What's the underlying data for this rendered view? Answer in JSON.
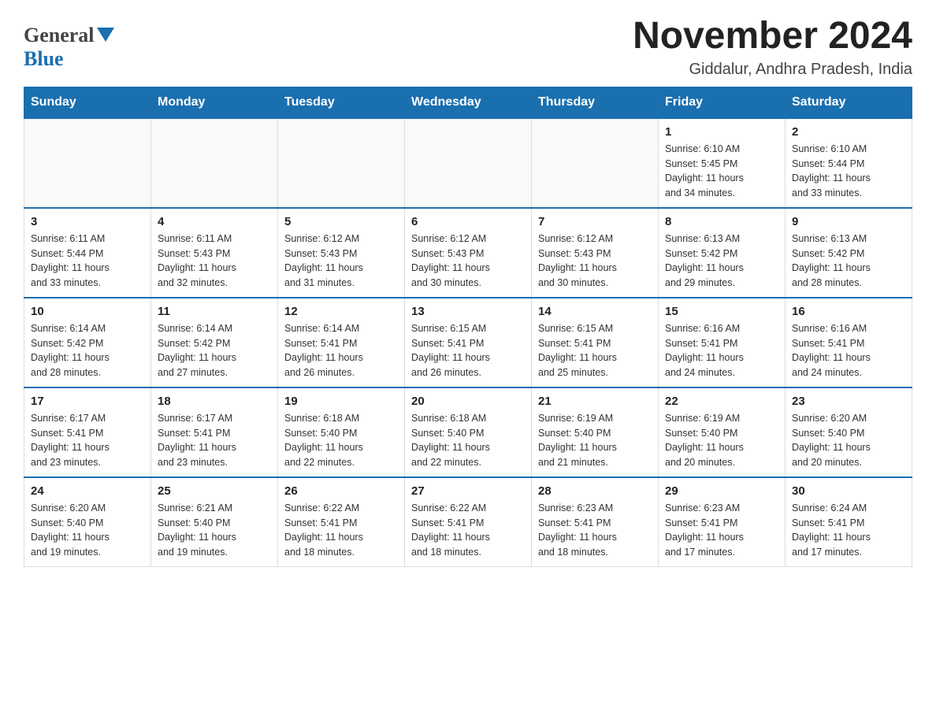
{
  "logo": {
    "general": "General",
    "blue": "Blue"
  },
  "header": {
    "title": "November 2024",
    "subtitle": "Giddalur, Andhra Pradesh, India"
  },
  "days_of_week": [
    "Sunday",
    "Monday",
    "Tuesday",
    "Wednesday",
    "Thursday",
    "Friday",
    "Saturday"
  ],
  "weeks": [
    [
      {
        "day": "",
        "info": ""
      },
      {
        "day": "",
        "info": ""
      },
      {
        "day": "",
        "info": ""
      },
      {
        "day": "",
        "info": ""
      },
      {
        "day": "",
        "info": ""
      },
      {
        "day": "1",
        "info": "Sunrise: 6:10 AM\nSunset: 5:45 PM\nDaylight: 11 hours\nand 34 minutes."
      },
      {
        "day": "2",
        "info": "Sunrise: 6:10 AM\nSunset: 5:44 PM\nDaylight: 11 hours\nand 33 minutes."
      }
    ],
    [
      {
        "day": "3",
        "info": "Sunrise: 6:11 AM\nSunset: 5:44 PM\nDaylight: 11 hours\nand 33 minutes."
      },
      {
        "day": "4",
        "info": "Sunrise: 6:11 AM\nSunset: 5:43 PM\nDaylight: 11 hours\nand 32 minutes."
      },
      {
        "day": "5",
        "info": "Sunrise: 6:12 AM\nSunset: 5:43 PM\nDaylight: 11 hours\nand 31 minutes."
      },
      {
        "day": "6",
        "info": "Sunrise: 6:12 AM\nSunset: 5:43 PM\nDaylight: 11 hours\nand 30 minutes."
      },
      {
        "day": "7",
        "info": "Sunrise: 6:12 AM\nSunset: 5:43 PM\nDaylight: 11 hours\nand 30 minutes."
      },
      {
        "day": "8",
        "info": "Sunrise: 6:13 AM\nSunset: 5:42 PM\nDaylight: 11 hours\nand 29 minutes."
      },
      {
        "day": "9",
        "info": "Sunrise: 6:13 AM\nSunset: 5:42 PM\nDaylight: 11 hours\nand 28 minutes."
      }
    ],
    [
      {
        "day": "10",
        "info": "Sunrise: 6:14 AM\nSunset: 5:42 PM\nDaylight: 11 hours\nand 28 minutes."
      },
      {
        "day": "11",
        "info": "Sunrise: 6:14 AM\nSunset: 5:42 PM\nDaylight: 11 hours\nand 27 minutes."
      },
      {
        "day": "12",
        "info": "Sunrise: 6:14 AM\nSunset: 5:41 PM\nDaylight: 11 hours\nand 26 minutes."
      },
      {
        "day": "13",
        "info": "Sunrise: 6:15 AM\nSunset: 5:41 PM\nDaylight: 11 hours\nand 26 minutes."
      },
      {
        "day": "14",
        "info": "Sunrise: 6:15 AM\nSunset: 5:41 PM\nDaylight: 11 hours\nand 25 minutes."
      },
      {
        "day": "15",
        "info": "Sunrise: 6:16 AM\nSunset: 5:41 PM\nDaylight: 11 hours\nand 24 minutes."
      },
      {
        "day": "16",
        "info": "Sunrise: 6:16 AM\nSunset: 5:41 PM\nDaylight: 11 hours\nand 24 minutes."
      }
    ],
    [
      {
        "day": "17",
        "info": "Sunrise: 6:17 AM\nSunset: 5:41 PM\nDaylight: 11 hours\nand 23 minutes."
      },
      {
        "day": "18",
        "info": "Sunrise: 6:17 AM\nSunset: 5:41 PM\nDaylight: 11 hours\nand 23 minutes."
      },
      {
        "day": "19",
        "info": "Sunrise: 6:18 AM\nSunset: 5:40 PM\nDaylight: 11 hours\nand 22 minutes."
      },
      {
        "day": "20",
        "info": "Sunrise: 6:18 AM\nSunset: 5:40 PM\nDaylight: 11 hours\nand 22 minutes."
      },
      {
        "day": "21",
        "info": "Sunrise: 6:19 AM\nSunset: 5:40 PM\nDaylight: 11 hours\nand 21 minutes."
      },
      {
        "day": "22",
        "info": "Sunrise: 6:19 AM\nSunset: 5:40 PM\nDaylight: 11 hours\nand 20 minutes."
      },
      {
        "day": "23",
        "info": "Sunrise: 6:20 AM\nSunset: 5:40 PM\nDaylight: 11 hours\nand 20 minutes."
      }
    ],
    [
      {
        "day": "24",
        "info": "Sunrise: 6:20 AM\nSunset: 5:40 PM\nDaylight: 11 hours\nand 19 minutes."
      },
      {
        "day": "25",
        "info": "Sunrise: 6:21 AM\nSunset: 5:40 PM\nDaylight: 11 hours\nand 19 minutes."
      },
      {
        "day": "26",
        "info": "Sunrise: 6:22 AM\nSunset: 5:41 PM\nDaylight: 11 hours\nand 18 minutes."
      },
      {
        "day": "27",
        "info": "Sunrise: 6:22 AM\nSunset: 5:41 PM\nDaylight: 11 hours\nand 18 minutes."
      },
      {
        "day": "28",
        "info": "Sunrise: 6:23 AM\nSunset: 5:41 PM\nDaylight: 11 hours\nand 18 minutes."
      },
      {
        "day": "29",
        "info": "Sunrise: 6:23 AM\nSunset: 5:41 PM\nDaylight: 11 hours\nand 17 minutes."
      },
      {
        "day": "30",
        "info": "Sunrise: 6:24 AM\nSunset: 5:41 PM\nDaylight: 11 hours\nand 17 minutes."
      }
    ]
  ]
}
